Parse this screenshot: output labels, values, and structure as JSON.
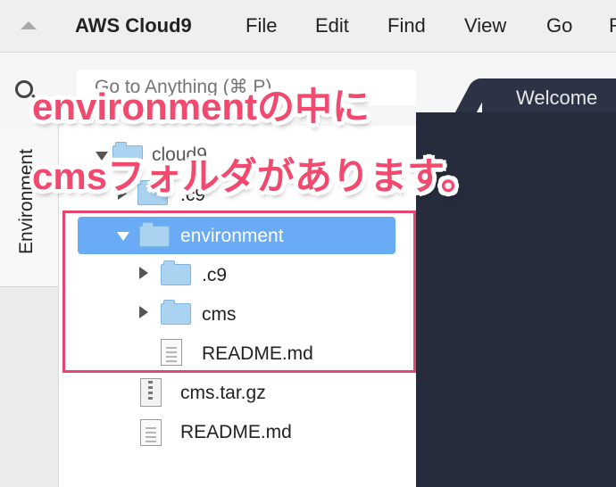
{
  "menubar": {
    "app_title": "AWS Cloud9",
    "items": [
      "File",
      "Edit",
      "Find",
      "View",
      "Go",
      "R"
    ]
  },
  "search": {
    "placeholder": "Go to Anything (⌘ P)"
  },
  "sidebar": {
    "environment_tab": "Environment"
  },
  "editor": {
    "welcome_tab": "Welcome"
  },
  "tree": {
    "root": "cloud9",
    "items": [
      {
        "label": ".c9",
        "type": "folder"
      },
      {
        "label": "environment",
        "type": "folder",
        "expanded": true,
        "selected": true
      },
      {
        "label": ".c9",
        "type": "folder"
      },
      {
        "label": "cms",
        "type": "folder"
      },
      {
        "label": "README.md",
        "type": "file"
      },
      {
        "label": "cms.tar.gz",
        "type": "archive"
      },
      {
        "label": "README.md",
        "type": "file"
      }
    ]
  },
  "annotation": {
    "line1": "environmentの中に",
    "line2": "cmsフォルダがあります。",
    "color": "#f2496f"
  },
  "colors": {
    "selection": "#6aabf5",
    "highlight_border": "#e8456e",
    "editor_bg": "#262c3b"
  }
}
